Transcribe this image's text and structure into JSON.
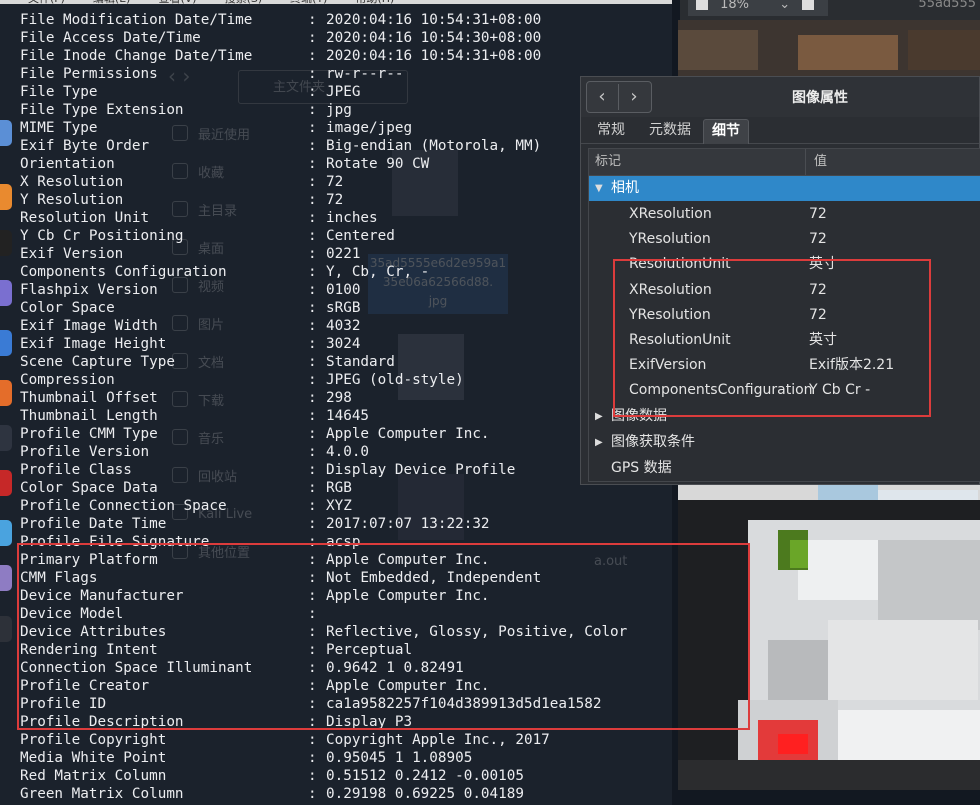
{
  "terminal": {
    "menu": [
      "文件(F)",
      "编辑(E)",
      "查看(V)",
      "搜索(S)",
      "终端(T)",
      "帮助(H)"
    ],
    "lines": [
      {
        "key": "File Modification Date/Time",
        "value": "2020:04:16 10:54:31+08:00"
      },
      {
        "key": "File Access Date/Time",
        "value": "2020:04:16 10:54:30+08:00"
      },
      {
        "key": "File Inode Change Date/Time",
        "value": "2020:04:16 10:54:31+08:00"
      },
      {
        "key": "File Permissions",
        "value": "rw-r--r--"
      },
      {
        "key": "File Type",
        "value": "JPEG"
      },
      {
        "key": "File Type Extension",
        "value": "jpg"
      },
      {
        "key": "MIME Type",
        "value": "image/jpeg"
      },
      {
        "key": "Exif Byte Order",
        "value": "Big-endian (Motorola, MM)"
      },
      {
        "key": "Orientation",
        "value": "Rotate 90 CW"
      },
      {
        "key": "X Resolution",
        "value": "72"
      },
      {
        "key": "Y Resolution",
        "value": "72"
      },
      {
        "key": "Resolution Unit",
        "value": "inches"
      },
      {
        "key": "Y Cb Cr Positioning",
        "value": "Centered"
      },
      {
        "key": "Exif Version",
        "value": "0221"
      },
      {
        "key": "Components Configuration",
        "value": "Y, Cb, Cr, -"
      },
      {
        "key": "Flashpix Version",
        "value": "0100"
      },
      {
        "key": "Color Space",
        "value": "sRGB"
      },
      {
        "key": "Exif Image Width",
        "value": "4032"
      },
      {
        "key": "Exif Image Height",
        "value": "3024"
      },
      {
        "key": "Scene Capture Type",
        "value": "Standard"
      },
      {
        "key": "Compression",
        "value": "JPEG (old-style)"
      },
      {
        "key": "Thumbnail Offset",
        "value": "298"
      },
      {
        "key": "Thumbnail Length",
        "value": "14645"
      },
      {
        "key": "Profile CMM Type",
        "value": "Apple Computer Inc."
      },
      {
        "key": "Profile Version",
        "value": "4.0.0"
      },
      {
        "key": "Profile Class",
        "value": "Display Device Profile"
      },
      {
        "key": "Color Space Data",
        "value": "RGB"
      },
      {
        "key": "Profile Connection Space",
        "value": "XYZ"
      },
      {
        "key": "Profile Date Time",
        "value": "2017:07:07 13:22:32"
      },
      {
        "key": "Profile File Signature",
        "value": "acsp"
      },
      {
        "key": "Primary Platform",
        "value": "Apple Computer Inc."
      },
      {
        "key": "CMM Flags",
        "value": "Not Embedded, Independent"
      },
      {
        "key": "Device Manufacturer",
        "value": "Apple Computer Inc."
      },
      {
        "key": "Device Model",
        "value": ""
      },
      {
        "key": "Device Attributes",
        "value": "Reflective, Glossy, Positive, Color"
      },
      {
        "key": "Rendering Intent",
        "value": "Perceptual"
      },
      {
        "key": "Connection Space Illuminant",
        "value": "0.9642 1 0.82491"
      },
      {
        "key": "Profile Creator",
        "value": "Apple Computer Inc."
      },
      {
        "key": "Profile ID",
        "value": "ca1a9582257f104d389913d5d1ea1582"
      },
      {
        "key": "Profile Description",
        "value": "Display P3"
      },
      {
        "key": "Profile Copyright",
        "value": "Copyright Apple Inc., 2017"
      },
      {
        "key": "Media White Point",
        "value": "0.95045 1 1.08905"
      },
      {
        "key": "Red Matrix Column",
        "value": "0.51512 0.2412 -0.00105"
      },
      {
        "key": "Green Matrix Column",
        "value": "0.29198 0.69225 0.04189"
      }
    ]
  },
  "file_manager": {
    "path_label": "主文件夹",
    "sidebar": [
      "最近使用",
      "收藏",
      "主目录",
      "桌面",
      "视频",
      "图片",
      "文档",
      "下载",
      "音乐",
      "回收站",
      "Kali Live",
      "其他位置"
    ],
    "selected_file": [
      "35ad5555e6d2e959a1",
      "35e06a62566d88.",
      "jpg"
    ],
    "other_file": "a.out"
  },
  "topbar": {
    "zoom": "18%",
    "right_text": "55ad555"
  },
  "dialog": {
    "title": "图像属性",
    "tabs": [
      "常规",
      "元数据",
      "细节"
    ],
    "active_tab": "细节",
    "columns": {
      "tag": "标记",
      "value": "值"
    },
    "groups": [
      {
        "label": "相机",
        "expanded": true,
        "rows": [
          {
            "tag": "XResolution",
            "value": "72"
          },
          {
            "tag": "YResolution",
            "value": "72"
          },
          {
            "tag": "ResolutionUnit",
            "value": "英寸"
          },
          {
            "tag": "XResolution",
            "value": "72"
          },
          {
            "tag": "YResolution",
            "value": "72"
          },
          {
            "tag": "ResolutionUnit",
            "value": "英寸"
          },
          {
            "tag": "ExifVersion",
            "value": "Exif版本2.21"
          },
          {
            "tag": "ComponentsConfiguration",
            "value": "Y Cb Cr -"
          }
        ]
      },
      {
        "label": "图像数据",
        "expanded": false,
        "rows": []
      },
      {
        "label": "图像获取条件",
        "expanded": false,
        "rows": []
      },
      {
        "label": "GPS 数据",
        "expanded": false,
        "rows": []
      }
    ]
  },
  "colors": {
    "highlight_box": "#dc3c3c",
    "selection": "#2f88c9",
    "terminal_bg": "#1b222c"
  }
}
